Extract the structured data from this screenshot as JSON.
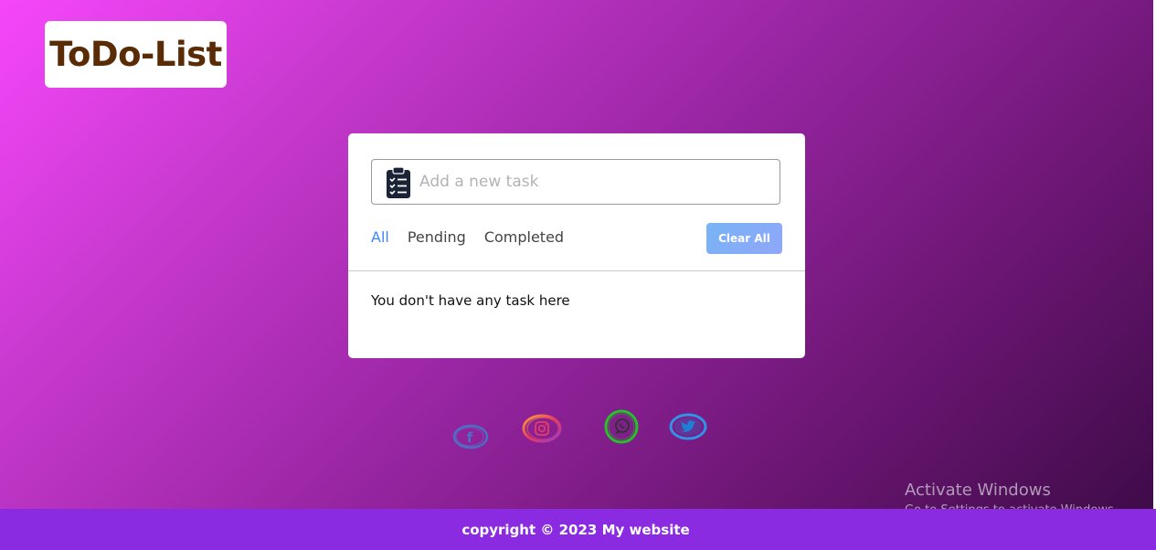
{
  "app": {
    "title": "ToDo-List"
  },
  "task_input": {
    "placeholder": "Add a new task",
    "value": ""
  },
  "filters": [
    {
      "label": "All",
      "active": true
    },
    {
      "label": "Pending",
      "active": false
    },
    {
      "label": "Completed",
      "active": false
    }
  ],
  "clear_button": {
    "label": "Clear All"
  },
  "task_list": {
    "empty_message": "You don't have any task here"
  },
  "social_links": [
    {
      "name": "facebook-icon",
      "glyph": "f"
    },
    {
      "name": "instagram-icon"
    },
    {
      "name": "whatsapp-icon"
    },
    {
      "name": "twitter-icon"
    }
  ],
  "footer": {
    "text": "copyright © 2023 My website"
  },
  "watermark": {
    "title": "Activate Windows",
    "subtitle": "Go to Settings to activate Windows."
  },
  "colors": {
    "logo_text": "#5a2c05",
    "active_filter": "#3c87ff",
    "footer_bg": "#8a2be2",
    "clear_button_bg": "#82aef7"
  }
}
